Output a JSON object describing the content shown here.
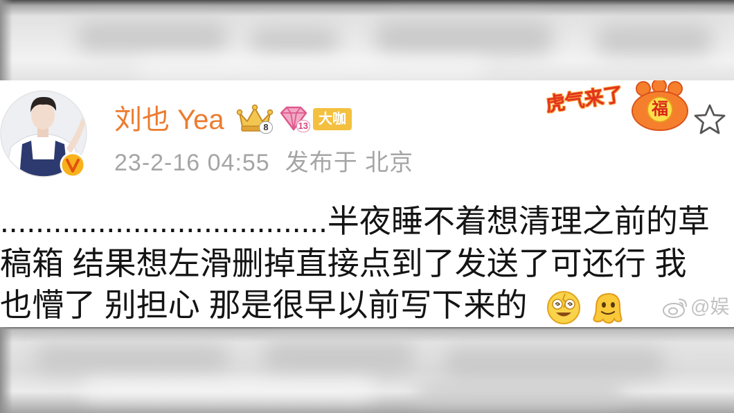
{
  "colors": {
    "name": "#ec7b2e",
    "meta": "#a5a5a5",
    "body": "#141414",
    "verified": "#f7b21c",
    "badge_daka": "#f4c03f",
    "sticker": "#e3321f",
    "watermark": "#c2c2c2"
  },
  "post": {
    "author": {
      "name": "刘也 Yea",
      "avatar_icon": "avatar-photo",
      "verified_icon": "verified-v-icon",
      "badges": [
        {
          "icon": "crown-icon",
          "level": "8"
        },
        {
          "icon": "gem-icon",
          "level": "13"
        },
        {
          "label": "大咖"
        }
      ]
    },
    "time": "23-2-16 04:55",
    "location": "发布于 北京",
    "favorite_icon": "star-icon",
    "sticker": {
      "text": "虎气来了",
      "paw_text": "福"
    },
    "lines": [
      ".....................................半夜睡不着想清理之前的草",
      "稿箱 结果想左滑删掉直接点到了发送了可还行 我",
      "也懵了 别担心 那是很早以前写下来的"
    ],
    "emojis": [
      "dizzy-face-emoji",
      "melting-face-emoji"
    ]
  },
  "watermark": {
    "icon": "weibo-logo-icon",
    "text": "@娱"
  }
}
